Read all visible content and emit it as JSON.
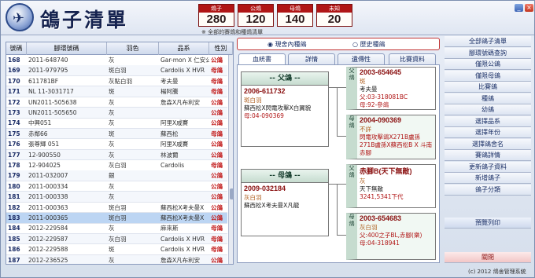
{
  "app": {
    "title": "鴿子清單",
    "copyright": "(c) 2012  鴿舍管理系統"
  },
  "stats": {
    "total": {
      "label": "鴿子",
      "value": "280"
    },
    "male": {
      "label": "公鴿",
      "value": "120"
    },
    "female": {
      "label": "母鴿",
      "value": "140"
    },
    "unknown": {
      "label": "未知",
      "value": "20"
    },
    "note": "※ 全部的賽鴿和種鴿清單"
  },
  "window": {
    "minimize": "_",
    "close": "×"
  },
  "table": {
    "headers": [
      "號碼",
      "腳環號碼",
      "羽色",
      "品系",
      "性別"
    ],
    "rows": [
      {
        "no": "168",
        "ring": "2011-648740",
        "color": "灰",
        "breed": "Gar-mon X 仁安公",
        "sex": "公鴿"
      },
      {
        "no": "169",
        "ring": "2011-979795",
        "color": "斑白羽",
        "breed": "Cardolis X HVR",
        "sex": "母鴿"
      },
      {
        "no": "170",
        "ring": "611781BF",
        "color": "灰點白羽",
        "breed": "考夫曼",
        "sex": "母鴿"
      },
      {
        "no": "171",
        "ring": "NL 11-3031717",
        "color": "斑",
        "breed": "楊阿騰",
        "sex": "母鴿"
      },
      {
        "no": "172",
        "ring": "UN2011-505638",
        "color": "灰",
        "breed": "詹森X凡布利安",
        "sex": "公鴿"
      },
      {
        "no": "173",
        "ring": "UN2011-505650",
        "color": "灰",
        "breed": "",
        "sex": "公鴿"
      },
      {
        "no": "174",
        "ring": "中興051",
        "color": "灰",
        "breed": "阿里X戚賽",
        "sex": "公鴿"
      },
      {
        "no": "175",
        "ring": "赤鄰66",
        "color": "斑",
        "breed": "蘇西松",
        "sex": "母鴿"
      },
      {
        "no": "176",
        "ring": "張尊輝 051",
        "color": "灰",
        "breed": "阿里X戚賽",
        "sex": "公鴿"
      },
      {
        "no": "177",
        "ring": "12-900550",
        "color": "灰",
        "breed": "林波爾",
        "sex": "公鴿"
      },
      {
        "no": "178",
        "ring": "12-904025",
        "color": "灰白羽",
        "breed": "Cardolis",
        "sex": "母鴿"
      },
      {
        "no": "179",
        "ring": "2011-032007",
        "color": "銀",
        "breed": "",
        "sex": "公鴿"
      },
      {
        "no": "180",
        "ring": "2011-000334",
        "color": "灰",
        "breed": "",
        "sex": "公鴿"
      },
      {
        "no": "181",
        "ring": "2011-000338",
        "color": "灰",
        "breed": "",
        "sex": "公鴿"
      },
      {
        "no": "182",
        "ring": "2011-000363",
        "color": "斑白羽",
        "breed": "蘇西松X考夫曼X",
        "sex": "公鴿"
      },
      {
        "no": "183",
        "ring": "2011-000365",
        "color": "斑白羽",
        "breed": "蘇西松X考夫曼X",
        "sex": "公鴿"
      },
      {
        "no": "184",
        "ring": "2012-229584",
        "color": "灰",
        "breed": "麻來斯",
        "sex": "母鴿"
      },
      {
        "no": "185",
        "ring": "2012-229587",
        "color": "灰白羽",
        "breed": "Cardolis X HVR",
        "sex": "母鴿"
      },
      {
        "no": "186",
        "ring": "2012-229588",
        "color": "斑",
        "breed": "Cardolis X HVR",
        "sex": "母鴿"
      },
      {
        "no": "187",
        "ring": "2012-236525",
        "color": "灰",
        "breed": "詹森X凡布利安",
        "sex": "公鴿"
      }
    ],
    "selected_index": 15
  },
  "pedigree": {
    "radio_current": "◉ 現舍內種鴿",
    "radio_history": "○ 歷史種鴿",
    "tabs": [
      "血統書",
      "詳情",
      "遺傳性",
      "比賽資料"
    ],
    "father": {
      "heading": "-- 父鴿 --",
      "ring": "2006-611732",
      "color": "斑白羽",
      "breed": "蘇西松X閃電攻擊X白翼貌",
      "pair": "母:04-090369"
    },
    "mother": {
      "heading": "-- 母鴿 --",
      "ring": "2009-032184",
      "color": "灰白羽",
      "breed": "蘇西松X考夫曼X凡龍"
    },
    "paternal_grandfather": {
      "tag": "父鴿",
      "ring": "2003-654645",
      "color": "斑",
      "breed": "考夫曼",
      "line1": "父:03-318081BC",
      "line2": "母:92-參鴿"
    },
    "paternal_grandmother": {
      "tag": "母鴿",
      "ring": "2004-090369",
      "color": "不詳",
      "line1": "閃電攻擊鴿X271B盧孫",
      "line2": "271B盧孫X蘇西松B X 斗南赤腳"
    },
    "maternal_grandfather": {
      "tag": "父鴿",
      "ring": "赤腳B(天下無敵)",
      "color": "灰",
      "breed": "天下無敵",
      "line1": "3241,5341下代"
    },
    "maternal_grandmother": {
      "tag": "母鴿",
      "ring": "2003-654683",
      "color": "灰白羽",
      "line1": "父:400之子BL,赤腳(樂)",
      "line2": "母:04-318941"
    }
  },
  "menu": [
    "全部鴿子清單",
    "腳環號碼查詢",
    "僅限公鴿",
    "僅限母鴿",
    "比賽鴿",
    "種鴿",
    "幼鴿",
    "選擇品系",
    "選擇年份",
    "選擇鴿舍名",
    "賽鴿詳情",
    "更新鴿子資料",
    "新增鴿子",
    "鴿子分類"
  ],
  "print_label": "預覽列印",
  "close_label": "關閉",
  "colors": {
    "accent_red": "#b01515",
    "selected_row": "#bcd5f3",
    "sex_text": "#c21a1a"
  }
}
